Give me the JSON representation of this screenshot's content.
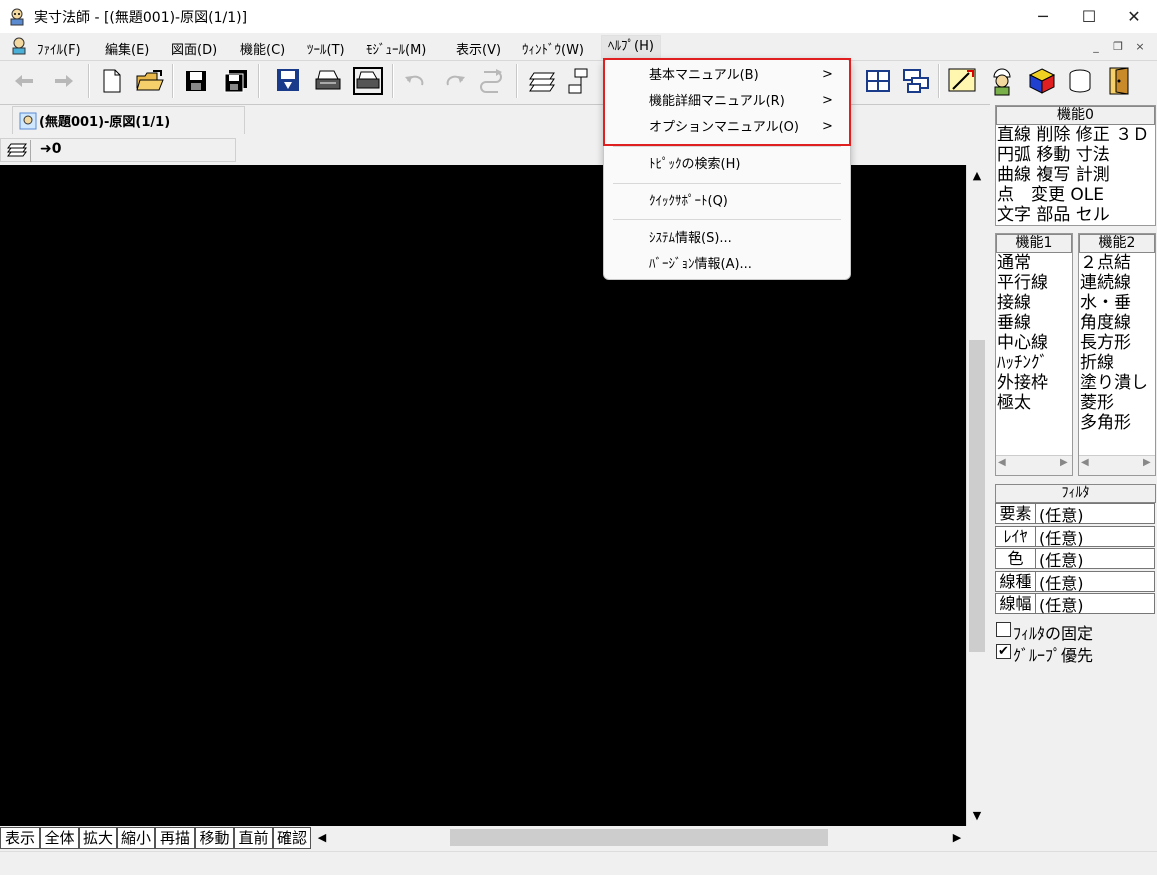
{
  "window": {
    "title": "実寸法師 - [(無題001)-原図(1/1)]",
    "minimize": "─",
    "maximize": "☐",
    "close": "✕"
  },
  "menubar": {
    "items": [
      "ﾌｧｲﾙ(F)",
      "編集(E)",
      "図面(D)",
      "機能(C)",
      "ﾂｰﾙ(T)",
      "ﾓｼﾞｭｰﾙ(M)",
      "表示(V)",
      "ｳｨﾝﾄﾞｳ(W)",
      "ﾍﾙﾌﾟ(H)"
    ],
    "mdi_min": "_",
    "mdi_restore": "❐",
    "mdi_close": "×"
  },
  "tab": {
    "label": "(無題001)-原図(1/1)"
  },
  "layer": {
    "value": "0"
  },
  "help_menu": {
    "items": [
      {
        "label": "基本マニュアル(B)",
        "submenu": true
      },
      {
        "label": "機能詳細マニュアル(R)",
        "submenu": true
      },
      {
        "label": "オプションマニュアル(O)",
        "submenu": true
      },
      {
        "label": "ﾄﾋﾟｯｸの検索(H)"
      },
      {
        "label": "ｸｲｯｸｻﾎﾟｰﾄ(Q)"
      },
      {
        "label": "ｼｽﾃﾑ情報(S)..."
      },
      {
        "label": "ﾊﾞｰｼﾞｮﾝ情報(A)..."
      }
    ],
    "arrow": ">"
  },
  "panel0": {
    "header": "機能0",
    "rows": [
      "直線 削除 修正 ３Ｄ",
      "円弧 移動 寸法",
      "曲線 複写 計測",
      "点　変更 OLE",
      "文字 部品 セル"
    ]
  },
  "panel1": {
    "header": "機能1",
    "items": [
      "通常",
      "平行線",
      "接線",
      "垂線",
      "中心線",
      "ﾊｯﾁﾝｸﾞ",
      "外接枠",
      "極太"
    ]
  },
  "panel2": {
    "header": "機能2",
    "items": [
      "２点結",
      "連続線",
      "水・垂",
      "角度線",
      "長方形",
      "折線",
      "塗り潰し",
      "菱形",
      "多角形"
    ]
  },
  "filter": {
    "header": "ﾌｨﾙﾀ",
    "rows": [
      {
        "key": "要素",
        "value": "(任意)"
      },
      {
        "key": "ﾚｲﾔ",
        "value": "(任意)"
      },
      {
        "key": "色",
        "value": "(任意)"
      },
      {
        "key": "線種",
        "value": "(任意)"
      },
      {
        "key": "線幅",
        "value": "(任意)"
      }
    ],
    "fix_label": "ﾌｨﾙﾀの固定",
    "fix_checked": false,
    "group_label": "ｸﾞﾙｰﾌﾟ優先",
    "group_checked": true,
    "check_mark": "✔"
  },
  "view_buttons": [
    "表示",
    "全体",
    "拡大",
    "縮小",
    "再描",
    "移動",
    "直前",
    "確認"
  ],
  "scroll": {
    "up": "▲",
    "down": "▼",
    "left": "◀",
    "right": "▶"
  },
  "colors": {
    "highlight": "#e02020",
    "canvas": "#000000",
    "face": "#f0f0f0"
  }
}
